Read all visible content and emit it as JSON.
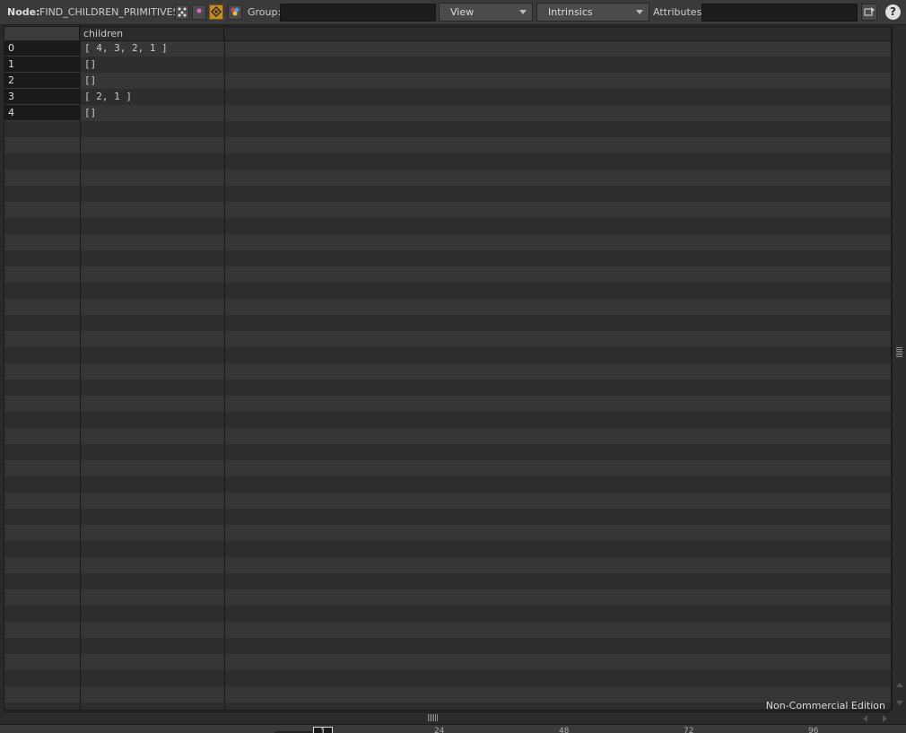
{
  "toolbar": {
    "node_label": "Node:",
    "node_name": "FIND_CHILDREN_PRIMITIVES",
    "group_label": "Group:",
    "group_value": "",
    "view_menu": "View",
    "intrinsics_menu": "Intrinsics",
    "attributes_label": "Attributes:",
    "attributes_value": "",
    "help_glyph": "?",
    "icons": [
      "points-icon",
      "vertices-icon",
      "primitives-icon",
      "detail-icon"
    ]
  },
  "spreadsheet": {
    "columns": [
      "children"
    ],
    "rows": [
      {
        "index": "0",
        "children": "[ 4, 3, 2, 1 ]"
      },
      {
        "index": "1",
        "children": "[]"
      },
      {
        "index": "2",
        "children": "[]"
      },
      {
        "index": "3",
        "children": "[ 2, 1 ]"
      },
      {
        "index": "4",
        "children": "[]"
      }
    ]
  },
  "footer": {
    "edition": "Non-Commercial Edition"
  },
  "timeline": {
    "current_frame": "1",
    "ticks": [
      "24",
      "48",
      "72",
      "96"
    ]
  },
  "colors": {
    "active_icon": "#c88a24",
    "background": "#2a2a2a",
    "stripe_light": "#363636",
    "stripe_dark": "#2d2d2d"
  }
}
